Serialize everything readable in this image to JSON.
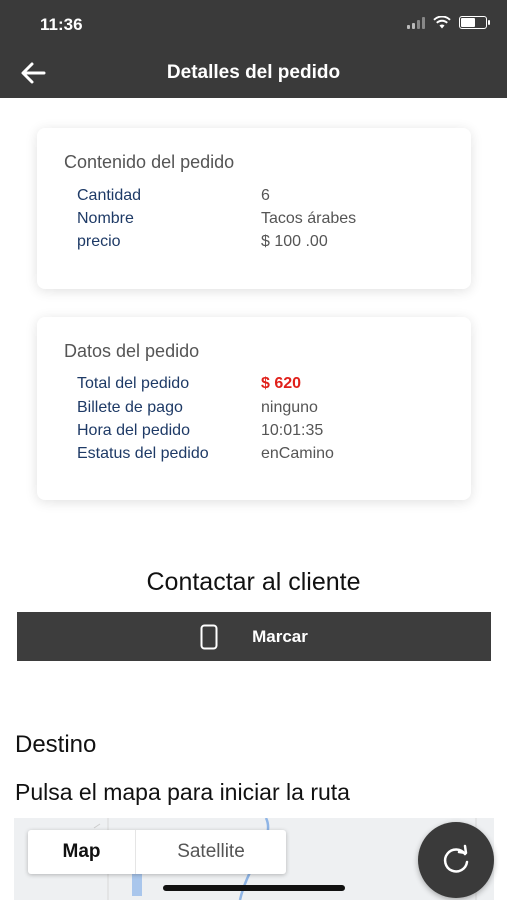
{
  "status_bar": {
    "time": "11:36"
  },
  "header": {
    "title": "Detalles del pedido"
  },
  "order_contents": {
    "title": "Contenido del pedido",
    "rows": [
      {
        "label": "Cantidad",
        "value": "6"
      },
      {
        "label": "Nombre",
        "value": "Tacos árabes"
      },
      {
        "label": "precio",
        "value": "$ 100 .00"
      }
    ]
  },
  "order_data": {
    "title": "Datos del pedido",
    "rows": [
      {
        "label": "Total del pedido",
        "value": "$ 620"
      },
      {
        "label": "Billete de pago",
        "value": "ninguno"
      },
      {
        "label": "Hora del pedido",
        "value": "10:01:35"
      },
      {
        "label": "Estatus del pedido",
        "value": "enCamino"
      }
    ],
    "total_color": "#e0201a"
  },
  "contact": {
    "title": "Contactar al cliente",
    "call_label": "Marcar"
  },
  "destination": {
    "title": "Destino",
    "hint": "Pulsa el mapa para iniciar la ruta"
  },
  "map": {
    "tabs": [
      "Map",
      "Satellite"
    ],
    "selected": "Map"
  },
  "colors": {
    "bar": "#3a3a3a",
    "label_blue": "#1e3a66",
    "accent_red": "#e0201a"
  }
}
